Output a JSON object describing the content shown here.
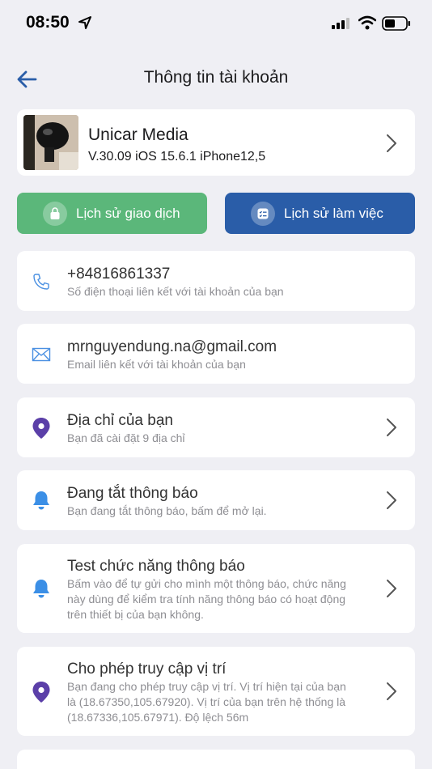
{
  "status_bar": {
    "time": "08:50"
  },
  "nav": {
    "title": "Thông tin tài khoản"
  },
  "profile": {
    "name": "Unicar Media",
    "version": "V.30.09 iOS 15.6.1 iPhone12,5"
  },
  "actions": {
    "history_transactions": "Lịch sử giao dịch",
    "history_work": "Lịch sử làm việc"
  },
  "rows": {
    "phone": {
      "title": "+84816861337",
      "sub": "Số điện thoại liên kết với tài khoản của bạn"
    },
    "email": {
      "title": "mrnguyendung.na@gmail.com",
      "sub": "Email liên kết với tài khoản của bạn"
    },
    "address": {
      "title": "Địa chỉ của bạn",
      "sub": "Bạn đã cài đặt 9 địa chỉ"
    },
    "notify_off": {
      "title": "Đang tắt thông báo",
      "sub": "Bạn đang tắt thông báo, bấm để mở lại."
    },
    "notify_test": {
      "title": "Test chức năng thông báo",
      "sub_line1": "Bấm vào để tự gửi cho mình một thông báo, chức năng",
      "sub_line2": "này dùng để kiểm tra tính năng thông báo có hoạt động",
      "sub_line3": "trên thiết bị của bạn không."
    },
    "location_access": {
      "title": "Cho phép truy cập vị trí",
      "sub_line1": "Bạn đang cho phép truy cập vị trí. Vị trí hiện tại của bạn",
      "sub_line2": "là (18.67350,105.67920). Vị trí của bạn trên hệ thống là",
      "sub_line3": "(18.67336,105.67971). Độ lệch 56m"
    }
  },
  "colors": {
    "green": "#5bb77a",
    "blue": "#2a5da8",
    "purple": "#5b3fa8",
    "light_blue_icon": "#4a90e2",
    "bell": "#3b8fe6"
  }
}
